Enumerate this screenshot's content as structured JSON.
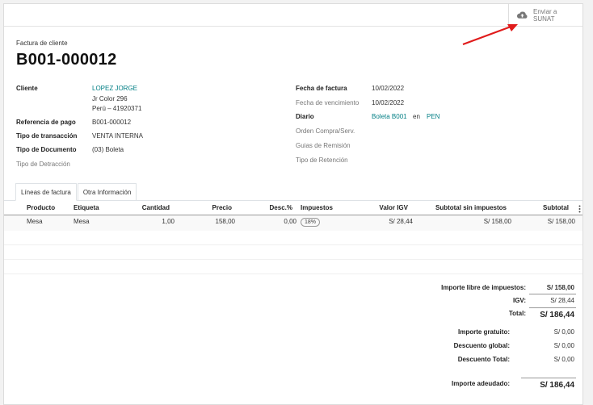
{
  "toolbar": {
    "sunat_button_label": "Enviar a SUNAT"
  },
  "header": {
    "doc_type": "Factura de cliente",
    "number": "B001-000012"
  },
  "left_fields": {
    "cliente_label": "Cliente",
    "cliente_name": "LOPEZ JORGE",
    "cliente_addr1": "Jr Color 296",
    "cliente_addr2": "Perú – 41920371",
    "ref_label": "Referencia de pago",
    "ref_value": "B001-000012",
    "trans_label": "Tipo de transacción",
    "trans_value": "VENTA INTERNA",
    "tipo_doc_label": "Tipo de Documento",
    "tipo_doc_value": "(03) Boleta",
    "detraccion_label": "Tipo de Detracción"
  },
  "right_fields": {
    "fecha_label": "Fecha de factura",
    "fecha_value": "10/02/2022",
    "venc_label": "Fecha de vencimiento",
    "venc_value": "10/02/2022",
    "diario_label": "Diario",
    "diario_value": "Boleta B001",
    "diario_en": "en",
    "diario_currency": "PEN",
    "orden_label": "Orden Compra/Serv.",
    "guias_label": "Guias de Remisión",
    "retencion_label": "Tipo de Retención"
  },
  "tabs": [
    "Líneas de factura",
    "Otra Información"
  ],
  "table": {
    "headers": {
      "producto": "Producto",
      "etiqueta": "Etiqueta",
      "cantidad": "Cantidad",
      "precio": "Precio",
      "desc": "Desc.%",
      "impuestos": "Impuestos",
      "valor_igv": "Valor IGV",
      "subtotal_sin": "Subtotal sin impuestos",
      "subtotal": "Subtotal"
    },
    "rows": [
      {
        "producto": "Mesa",
        "etiqueta": "Mesa",
        "cantidad": "1,00",
        "precio": "158,00",
        "desc": "0,00",
        "impuesto": "18%",
        "valor_igv": "S/ 28,44",
        "subtotal_sin": "S/ 158,00",
        "subtotal": "S/ 158,00"
      }
    ]
  },
  "totals": {
    "libre_label": "Importe libre de impuestos:",
    "libre_value": "S/ 158,00",
    "igv_label": "IGV:",
    "igv_value": "S/ 28,44",
    "total_label": "Total:",
    "total_value": "S/ 186,44",
    "gratuito_label": "Importe gratuito:",
    "gratuito_value": "S/ 0,00",
    "desc_global_label": "Descuento global:",
    "desc_global_value": "S/ 0,00",
    "desc_total_label": "Descuento Total:",
    "desc_total_value": "S/ 0,00",
    "adeudado_label": "Importe adeudado:",
    "adeudado_value": "S/ 186,44"
  },
  "colors": {
    "link": "#017e84",
    "arrow": "#e01b1b",
    "cloud_icon": "#777777"
  }
}
